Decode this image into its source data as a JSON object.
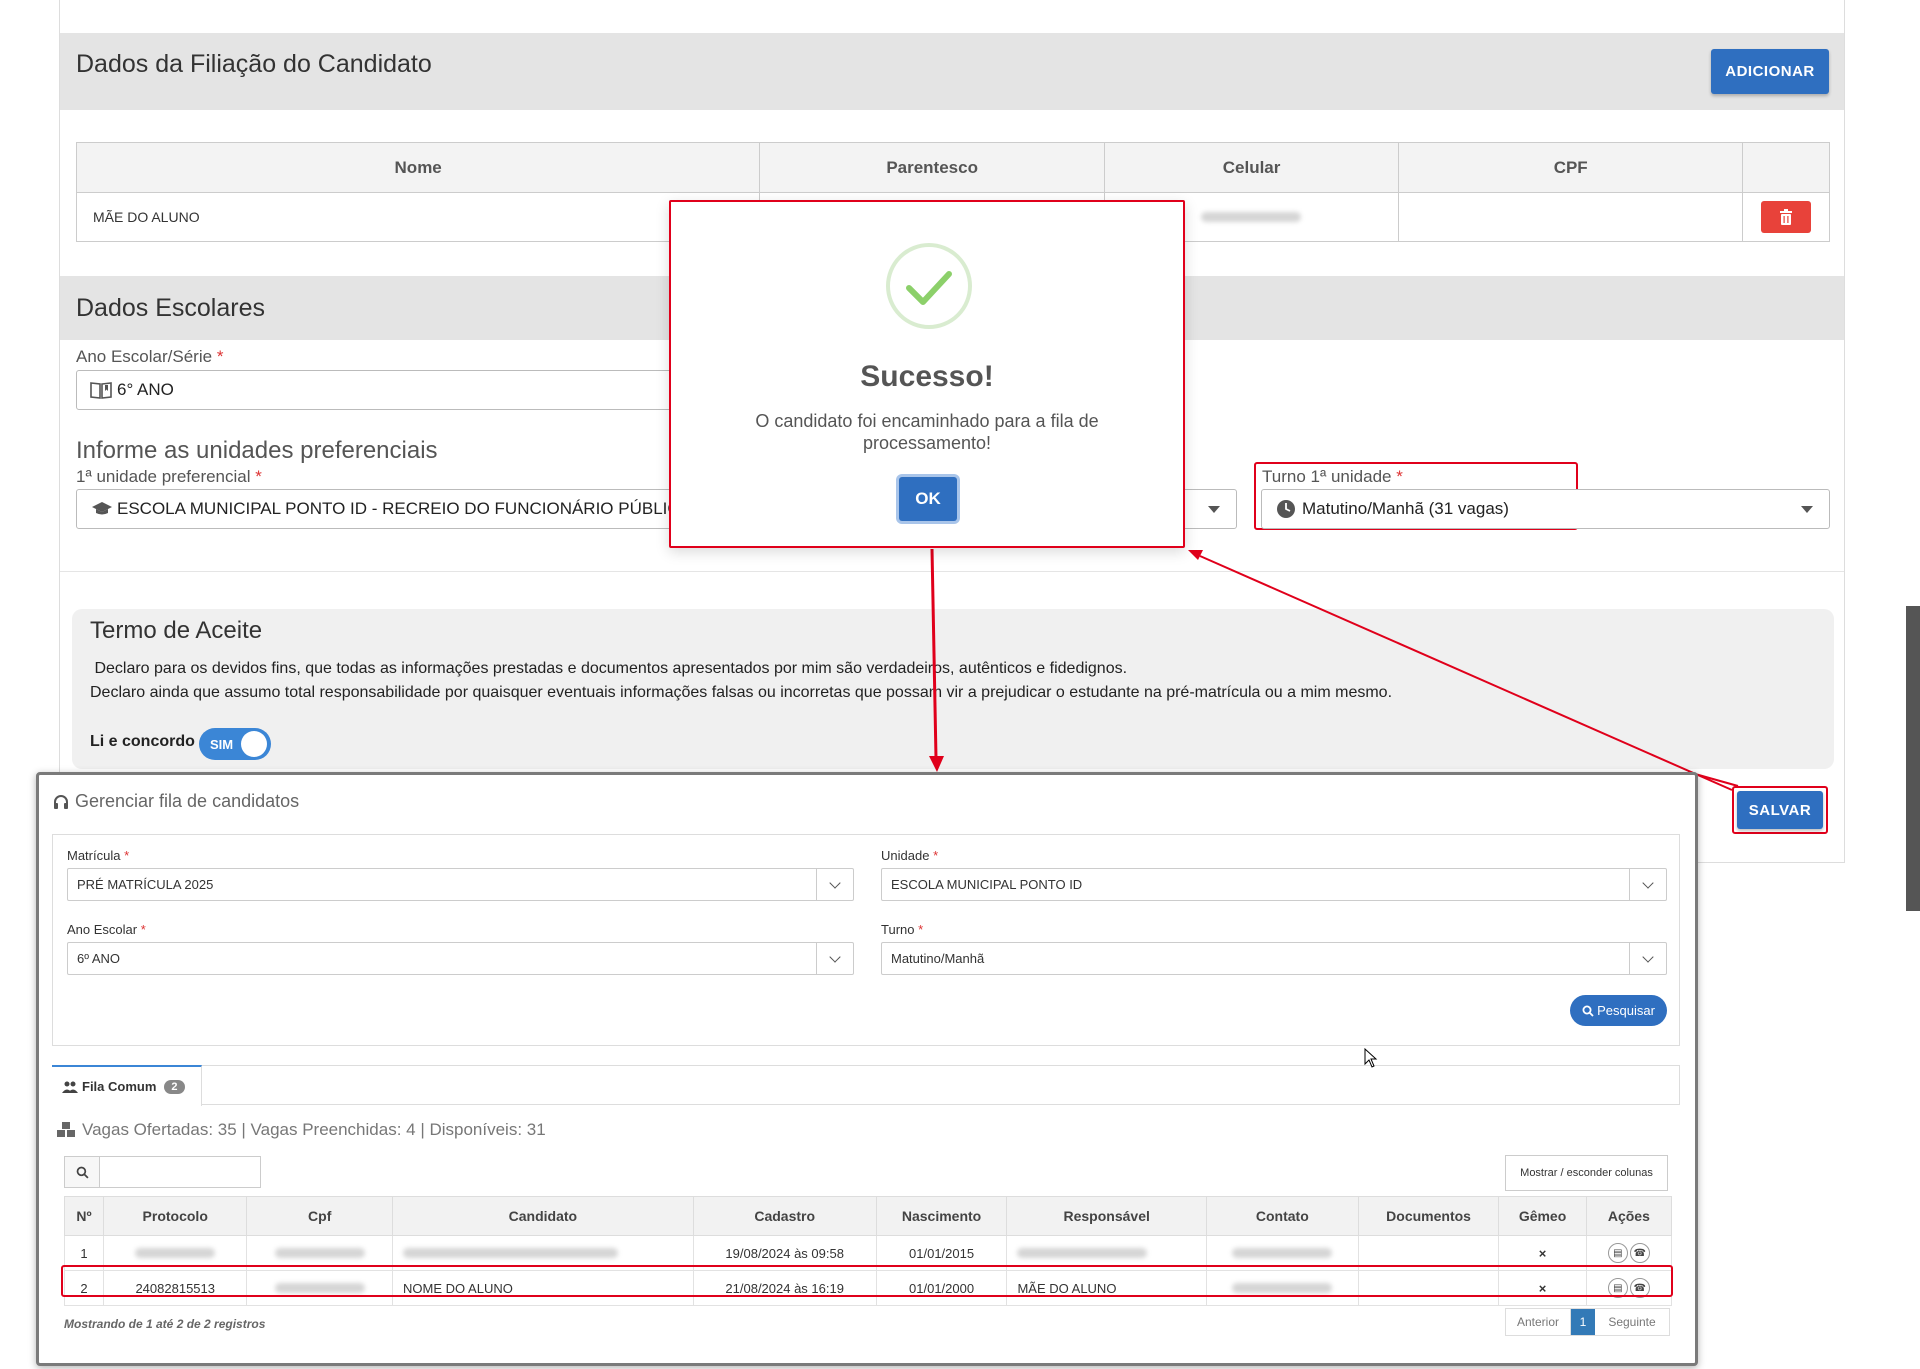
{
  "filiacao": {
    "title": "Dados da Filiação do Candidato",
    "add_button": "ADICIONAR",
    "columns": [
      "Nome",
      "Parentesco",
      "Celular",
      "CPF"
    ],
    "row": {
      "nome": "MÃE DO ALUNO"
    }
  },
  "escolares": {
    "title": "Dados Escolares",
    "ano_label": "Ano Escolar/Série",
    "ano_value": "6° ANO",
    "unidades_heading": "Informe as unidades preferenciais",
    "unidade1_label": "1ª unidade preferencial",
    "unidade1_value": "ESCOLA MUNICIPAL PONTO ID - RECREIO DO FUNCIONÁRIO PÚBLICO",
    "turno_label": "Turno 1ª unidade",
    "turno_value": "Matutino/Manhã (31 vagas)"
  },
  "termo": {
    "title": "Termo de Aceite",
    "line1": " Declaro para os devidos fins, que todas as informações prestadas e documentos apresentados por mim são verdadeiros, autênticos e fidedignos.",
    "line2": "Declaro ainda que assumo total responsabilidade por quaisquer eventuais informações falsas ou incorretas que possam vir a prejudicar o estudante na pré-matrícula ou a mim mesmo.",
    "agree_label": "Li e concordo",
    "toggle_label": "SIM"
  },
  "save_button": "SALVAR",
  "modal": {
    "title": "Sucesso!",
    "message": "O candidato foi encaminhado para a fila de processamento!",
    "ok": "OK"
  },
  "fila": {
    "title": "Gerenciar fila de candidatos",
    "matricula_label": "Matrícula",
    "matricula_value": "PRÉ MATRÍCULA 2025",
    "unidade_label": "Unidade",
    "unidade_value": "ESCOLA MUNICIPAL PONTO ID",
    "ano_label": "Ano Escolar",
    "ano_value": "6º ANO",
    "turno_label": "Turno",
    "turno_value": "Matutino/Manhã",
    "search_button": "Pesquisar",
    "tab_label": "Fila Comum",
    "tab_count": "2",
    "vagas": "Vagas Ofertadas: 35 | Vagas Preenchidas: 4 | Disponíveis: 31",
    "columns_button": "Mostrar / esconder colunas",
    "columns": [
      "Nº",
      "Protocolo",
      "Cpf",
      "Candidato",
      "Cadastro",
      "Nascimento",
      "Responsável",
      "Contato",
      "Documentos",
      "Gêmeo",
      "Ações"
    ],
    "rows": [
      {
        "n": "1",
        "protocolo": "",
        "cpf": "",
        "candidato": "",
        "cadastro": "19/08/2024 às 09:58",
        "nascimento": "01/01/2015",
        "responsavel": "",
        "contato": "",
        "documentos": "",
        "gemeo": "×"
      },
      {
        "n": "2",
        "protocolo": "24082815513",
        "cpf": "",
        "candidato": "NOME DO ALUNO",
        "cadastro": "21/08/2024 às 16:19",
        "nascimento": "01/01/2000",
        "responsavel": "MÃE DO ALUNO",
        "contato": "",
        "documentos": "",
        "gemeo": "×"
      }
    ],
    "info": "Mostrando de 1 até 2 de 2 registros",
    "prev": "Anterior",
    "page": "1",
    "next": "Seguinte"
  }
}
